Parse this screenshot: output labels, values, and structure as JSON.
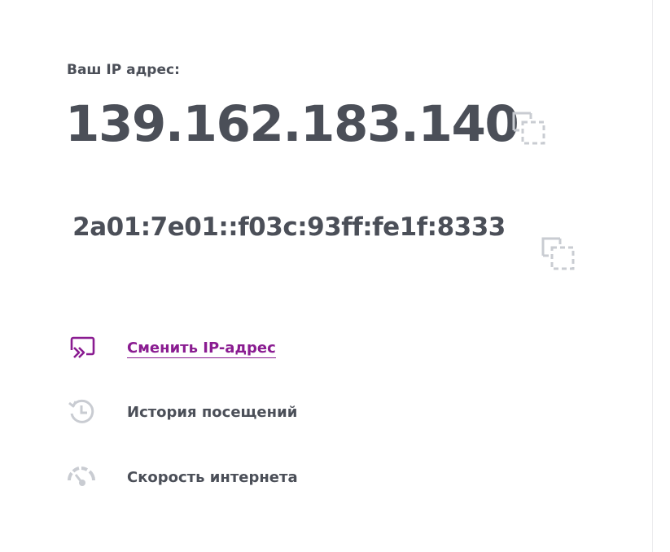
{
  "ip_block": {
    "label": "Ваш IP адрес:",
    "ipv4": "139.162.183.140",
    "ipv6": "2a01:7e01::f03c:93ff:fe1f:8333"
  },
  "menu": {
    "change_ip": {
      "label": "Сменить IP-адрес",
      "icon": "change-ip-icon"
    },
    "history": {
      "label": "История посещений",
      "icon": "history-icon"
    },
    "speed": {
      "label": "Скорость интернета",
      "icon": "speedometer-icon"
    }
  },
  "colors": {
    "text": "#4b4f58",
    "accent": "#8a1c91",
    "icon_gray": "#c9ccd2"
  }
}
